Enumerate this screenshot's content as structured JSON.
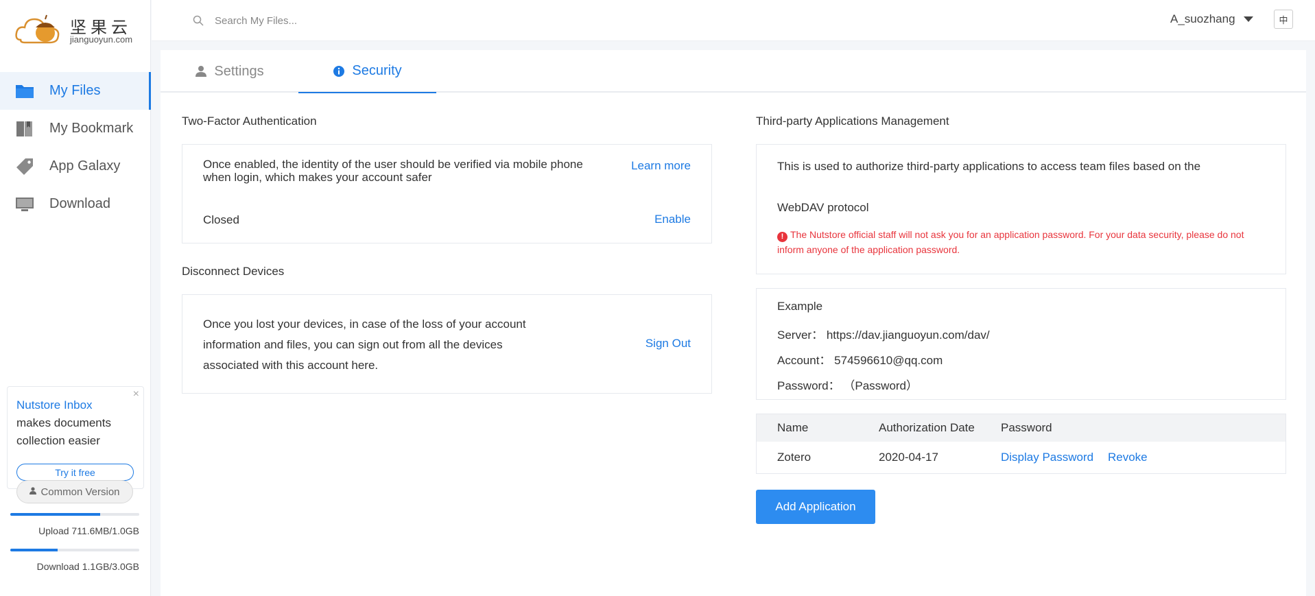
{
  "brand": {
    "name_cn": "坚果云",
    "name_en": "jianguoyun.com"
  },
  "search": {
    "placeholder": "Search My Files..."
  },
  "user": {
    "name": "A_suozhang",
    "lang_toggle": "中"
  },
  "sidebar": {
    "items": [
      {
        "label": "My Files",
        "icon": "folder-icon",
        "active": true
      },
      {
        "label": "My Bookmark",
        "icon": "bookmark-icon",
        "active": false
      },
      {
        "label": "App Galaxy",
        "icon": "tag-icon",
        "active": false
      },
      {
        "label": "Download",
        "icon": "monitor-icon",
        "active": false
      }
    ],
    "promo": {
      "link_text": "Nutstore Inbox",
      "text": "makes documents collection easier",
      "button": "Try it free",
      "close": "×"
    },
    "version_button": "Common Version",
    "upload": {
      "label": "Upload 711.6MB/1.0GB",
      "fraction": 0.695
    },
    "download": {
      "label": "Download 1.1GB/3.0GB",
      "fraction": 0.367
    }
  },
  "tabs": [
    {
      "label": "Settings",
      "icon": "person-icon",
      "active": false
    },
    {
      "label": "Security",
      "icon": "info-icon",
      "active": true
    }
  ],
  "two_factor": {
    "title": "Two-Factor Authentication",
    "description": "Once enabled, the identity of the user should be verified via mobile phone when login, which makes your account safer",
    "learn_more": "Learn more",
    "status": "Closed",
    "action": "Enable"
  },
  "disconnect": {
    "title": "Disconnect Devices",
    "description": "Once you lost your devices, in case of the loss of your account information and files, you can sign out from all the devices associated with this account here.",
    "action": "Sign Out"
  },
  "third_party": {
    "title": "Third-party Applications Management",
    "description_line1": "This is used to authorize third-party applications to access team files based on the",
    "description_line2": "WebDAV protocol",
    "warning": "The Nutstore official staff will not ask you for an application password. For your data security, please do not inform anyone of the application password.",
    "example": {
      "title": "Example",
      "server_label": "Server：",
      "server": "https://dav.jianguoyun.com/dav/",
      "account_label": "Account：",
      "account": "574596610@qq.com",
      "password_label": "Password：",
      "password": "（Password）"
    },
    "table": {
      "headers": [
        "Name",
        "Authorization Date",
        "Password"
      ],
      "rows": [
        {
          "name": "Zotero",
          "date": "2020-04-17",
          "display": "Display Password",
          "revoke": "Revoke"
        }
      ]
    },
    "add_button": "Add Application"
  },
  "colors": {
    "accent": "#1d7ae3",
    "warning": "#e8343c",
    "button": "#2d8cf0"
  }
}
